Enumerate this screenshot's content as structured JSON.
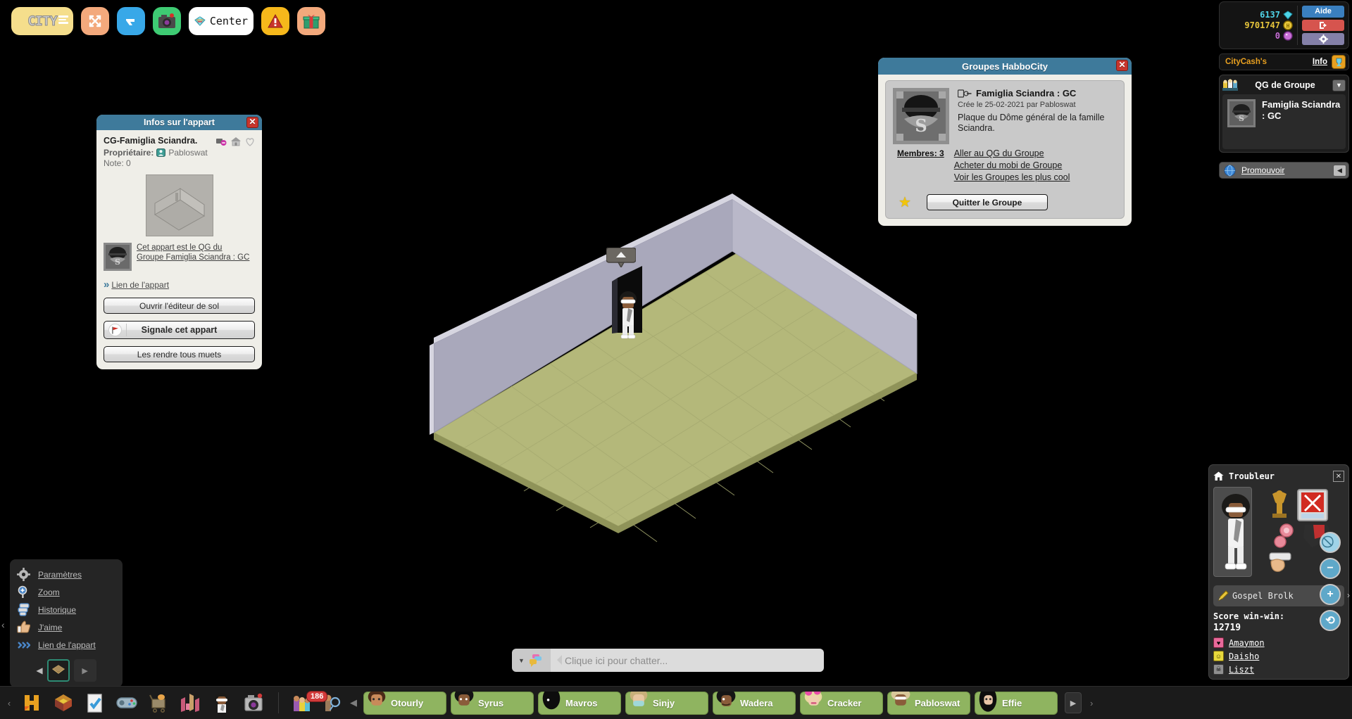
{
  "topnav": {
    "items": [
      {
        "name": "city-logo",
        "label": "CITY",
        "icon": "city-logo-icon"
      },
      {
        "name": "fullscreen",
        "label": "",
        "icon": "expand-arrows-icon"
      },
      {
        "name": "navigator",
        "label": "",
        "icon": "hand-pointer-icon"
      },
      {
        "name": "camera",
        "label": "",
        "icon": "camera-icon"
      },
      {
        "name": "center",
        "label": "Center",
        "icon": "diamond-icon"
      },
      {
        "name": "alerts",
        "label": "",
        "icon": "warning-icon"
      },
      {
        "name": "gift",
        "label": "",
        "icon": "gift-icon"
      }
    ]
  },
  "credits": {
    "diamonds": "6137",
    "coins": "9701747",
    "pink": "0",
    "aide_label": "Aide",
    "exit_icon": "exit-icon",
    "gear_icon": "gear-icon"
  },
  "citycash": {
    "label": "CityCash's",
    "info_label": "Info",
    "trophy_icon": "trophy-icon"
  },
  "qg_panel": {
    "title": "QG de Groupe",
    "group_name": "Famiglia Sciandra : GC",
    "badge_icon": "group-badge-icon",
    "caret": "▼"
  },
  "promote": {
    "label": "Promouvoir",
    "icon": "globe-icon",
    "caret": "◀"
  },
  "infos_appart": {
    "title": "Infos sur l'appart",
    "room_name": "CG-Famiglia Sciandra.",
    "owner_label": "Propriétaire:",
    "owner_name": "Pabloswat",
    "note_label": "Note:",
    "note_value": "0",
    "group_link_line1": "Cet appart est le QG du",
    "group_link_line2": "Groupe Famiglia Sciandra : GC",
    "link_label": "Lien de l'appart",
    "btn_floor_editor": "Ouvrir l'éditeur de sol",
    "btn_report": "Signale cet appart",
    "btn_mute_all": "Les rendre tous muets",
    "icons": [
      "mute-badge-icon",
      "home-icon",
      "heart-icon"
    ]
  },
  "groupes": {
    "title": "Groupes HabboCity",
    "group_name": "Famiglia Sciandra : GC",
    "created": "Crée le 25-02-2021 par Pabloswat",
    "description": "Plaque du Dôme général de la famille Sciandra.",
    "members_label": "Membres: 3",
    "links": [
      "Aller au QG du Groupe",
      "Acheter du mobi de Groupe",
      "Voir les Groupes les plus cool"
    ],
    "quit_label": "Quitter le Groupe",
    "star_icon": "star-icon",
    "badge_icon": "group-badge-icon"
  },
  "troubleur": {
    "title": "Troubleur",
    "home_icon": "home-icon",
    "close_icon": "close-icon",
    "nickname": "Gospel Brolk",
    "pencil_icon": "pencil-icon",
    "score_label": "Score win-win:",
    "score_value": "12719",
    "friends": [
      {
        "name": "Amaymon",
        "icon": "heart-badge-icon"
      },
      {
        "name": "Daisho",
        "icon": "smiley-badge-icon"
      },
      {
        "name": "Liszt",
        "icon": "skull-badge-icon"
      }
    ],
    "overlay_buttons": [
      "block-icon",
      "minus-icon",
      "plus-icon",
      "rotate-icon"
    ]
  },
  "context_menu": {
    "items": [
      {
        "label": "Paramètres",
        "icon": "gear-icon"
      },
      {
        "label": "Zoom",
        "icon": "magnifier-plus-icon"
      },
      {
        "label": "Historique",
        "icon": "chat-history-icon"
      },
      {
        "label": "J'aime",
        "icon": "thumbs-up-icon"
      },
      {
        "label": "Lien de l'appart",
        "icon": "chevrons-right-icon"
      }
    ],
    "pager_prev": "◀",
    "pager_next": "▶",
    "tile_icon": "furni-tile-icon"
  },
  "chat": {
    "placeholder": "Clique ici pour chatter...",
    "style_icon": "chat-bubble-icon",
    "dropdown_caret": "▼"
  },
  "bottombar": {
    "collapse": "‹",
    "icons": [
      "habbo-h-icon",
      "inventory-cube-icon",
      "quests-clipboard-icon",
      "games-controller-icon",
      "catalog-cart-icon",
      "room-builder-icon",
      "avatar-profile-icon",
      "camera-icon"
    ],
    "people_count": "186",
    "people_icon": "friends-icon",
    "search_icon": "friend-search-icon",
    "prev_arrow": "◀",
    "next_arrow": "▶",
    "right_caret": "›",
    "users": [
      "Otourly",
      "Syrus",
      "Mavros",
      "Sinjy",
      "Wadera",
      "Cracker",
      "Pabloswat",
      "Effie"
    ]
  },
  "room": {
    "avatar_name": "Gospel Brolk",
    "bubble_icon": "up-arrow-icon",
    "floor_color": "#b4b87a",
    "wall_color": "#a9a8bb"
  }
}
